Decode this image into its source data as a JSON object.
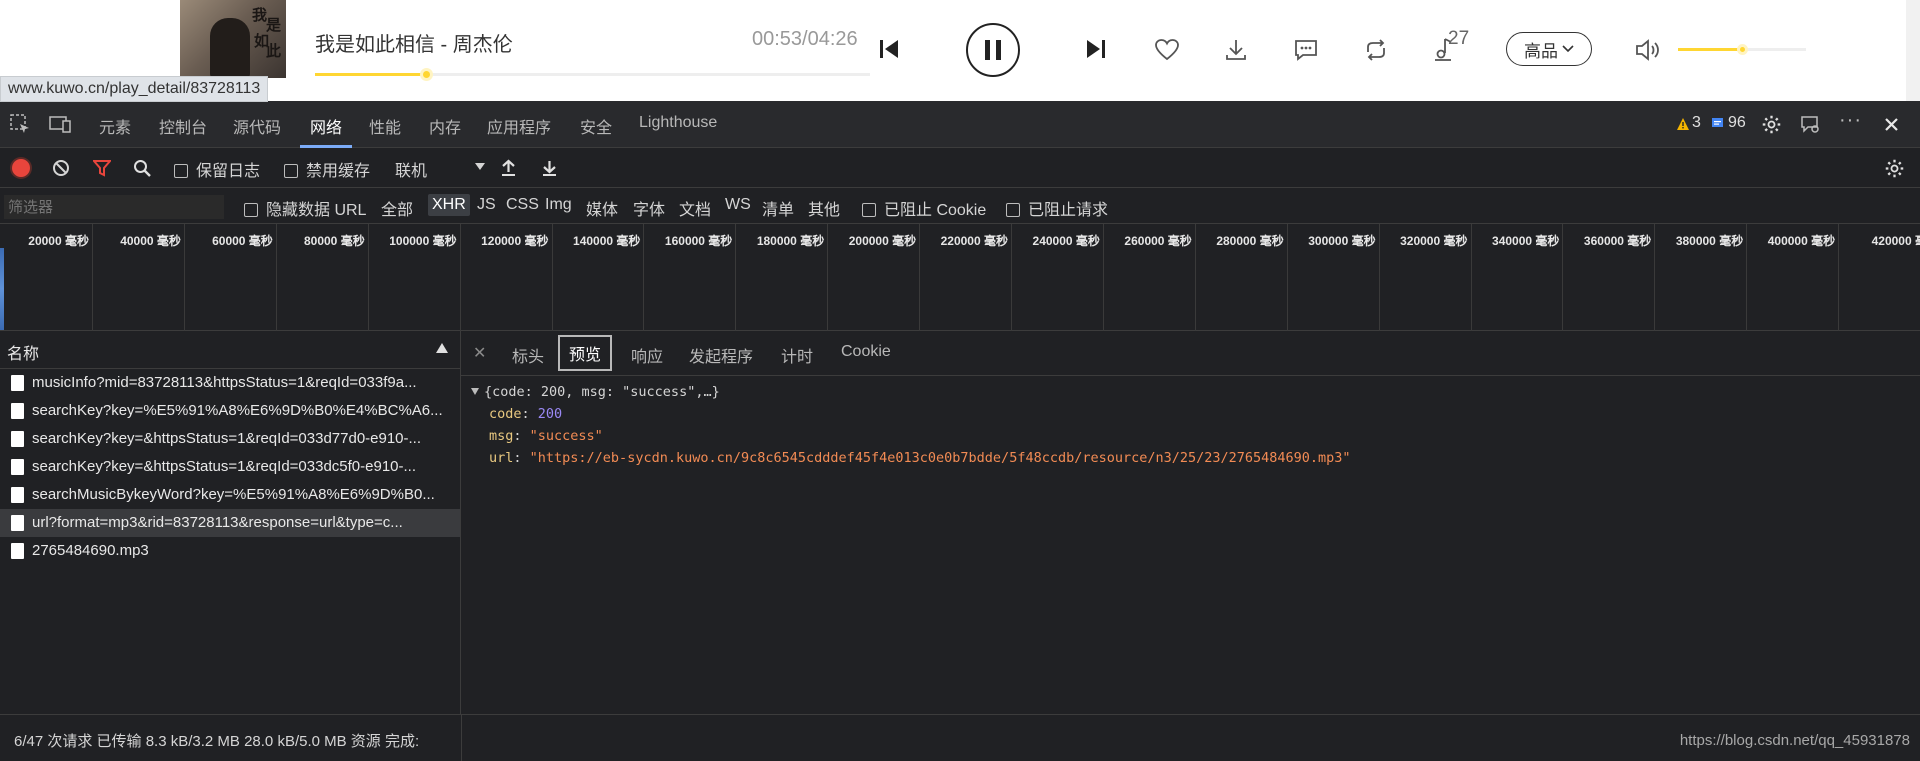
{
  "player": {
    "song_title": "我是如此相信 - 周杰伦",
    "time": "00:53/04:26",
    "progress": 0.2,
    "like_count": "27",
    "quality_label": "高品",
    "volume": 0.5,
    "status_url": "www.kuwo.cn/play_detail/83728113",
    "album_glyphs": [
      "我",
      "是",
      "如",
      "此"
    ]
  },
  "devtools": {
    "tabs": [
      "元素",
      "控制台",
      "源代码",
      "网络",
      "性能",
      "内存",
      "应用程序",
      "安全",
      "Lighthouse"
    ],
    "active_tab": "网络",
    "warnings_count": "3",
    "messages_count": "96",
    "toolbar": {
      "preserve_log": "保留日志",
      "disable_cache": "禁用缓存",
      "throttle": "联机"
    },
    "filter": {
      "placeholder": "筛选器",
      "hide_data_url": "隐藏数据 URL",
      "types": [
        "全部",
        "XHR",
        "JS",
        "CSS",
        "Img",
        "媒体",
        "字体",
        "文档",
        "WS",
        "清单",
        "其他"
      ],
      "selected_type": "XHR",
      "blocked_cookies": "已阻止 Cookie",
      "blocked_requests": "已阻止请求"
    },
    "overview_ticks": [
      "20000 毫秒",
      "40000 毫秒",
      "60000 毫秒",
      "80000 毫秒",
      "100000 毫秒",
      "120000 毫秒",
      "140000 毫秒",
      "160000 毫秒",
      "180000 毫秒",
      "200000 毫秒",
      "220000 毫秒",
      "240000 毫秒",
      "260000 毫秒",
      "280000 毫秒",
      "300000 毫秒",
      "320000 毫秒",
      "340000 毫秒",
      "360000 毫秒",
      "380000 毫秒",
      "400000 毫秒",
      "420000 毫"
    ],
    "request_list": {
      "header": "名称",
      "rows": [
        "musicInfo?mid=83728113&httpsStatus=1&reqId=033f9a...",
        "searchKey?key=%E5%91%A8%E6%9D%B0%E4%BC%A6...",
        "searchKey?key=&httpsStatus=1&reqId=033d77d0-e910-...",
        "searchKey?key=&httpsStatus=1&reqId=033dc5f0-e910-...",
        "searchMusicBykeyWord?key=%E5%91%A8%E6%9D%B0...",
        "url?format=mp3&rid=83728113&response=url&type=c...",
        "2765484690.mp3"
      ],
      "selected_index": 5
    },
    "detail_tabs": [
      "标头",
      "预览",
      "响应",
      "发起程序",
      "计时",
      "Cookie"
    ],
    "active_detail_tab": "预览",
    "preview": {
      "summary": "{code: 200, msg: \"success\",…}",
      "code_key": "code",
      "code_val": "200",
      "msg_key": "msg",
      "msg_val": "\"success\"",
      "url_key": "url",
      "url_val": "\"https://eb-sycdn.kuwo.cn/9c8c6545cdddef45f4e013c0e0b7bdde/5f48ccdb/resource/n3/25/23/2765484690.mp3\""
    },
    "status_bar": "6/47 次请求  已传输 8.3 kB/3.2 MB  28.0 kB/5.0 MB 资源  完成:",
    "watermark": "https://blog.csdn.net/qq_45931878"
  },
  "colors": {
    "accent_yellow": "#ffd632",
    "record_red": "#e8453c",
    "devtools_bg": "#202124"
  }
}
